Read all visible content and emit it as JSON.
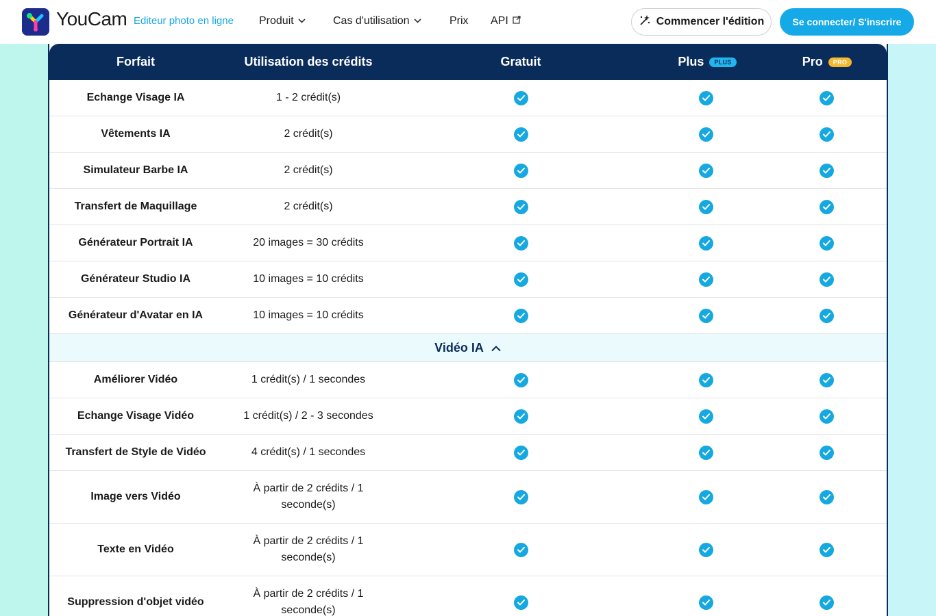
{
  "header": {
    "brand": "YouCam",
    "tagline": "Editeur photo en ligne",
    "nav": [
      {
        "label": "Produit",
        "icon": "chevron-down-icon"
      },
      {
        "label": "Cas d'utilisation",
        "icon": "chevron-down-icon"
      },
      {
        "label": "Prix"
      },
      {
        "label": "API",
        "icon": "external-link-icon"
      }
    ],
    "start_button": "Commencer l'édition",
    "login_button": "Se connecter/ S'inscrire"
  },
  "table": {
    "columns": [
      "Forfait",
      "Utilisation des crédits",
      "Gratuit",
      "Plus",
      "Pro"
    ],
    "plus_badge": "PLUS",
    "pro_badge": "PRO",
    "rows_top": [
      {
        "name": "Echange Visage IA",
        "credits": "1 - 2 crédit(s)"
      },
      {
        "name": "Vêtements IA",
        "credits": "2 crédit(s)"
      },
      {
        "name": "Simulateur Barbe IA",
        "credits": "2 crédit(s)"
      },
      {
        "name": "Transfert de Maquillage",
        "credits": "2 crédit(s)"
      },
      {
        "name": "Générateur Portrait IA",
        "credits": "20 images = 30 crédits"
      },
      {
        "name": "Générateur Studio IA",
        "credits": "10 images = 10 crédits"
      },
      {
        "name": "Générateur d'Avatar en IA",
        "credits": "10 images = 10 crédits"
      }
    ],
    "section_label": "Vidéo IA",
    "rows_video": [
      {
        "name": "Améliorer Vidéo",
        "credits": "1 crédit(s) / 1 secondes"
      },
      {
        "name": "Echange Visage Vidéo",
        "credits": "1 crédit(s) / 2 - 3 secondes"
      },
      {
        "name": "Transfert de Style de Vidéo",
        "credits": "4 crédit(s) / 1 secondes"
      },
      {
        "name": "Image vers Vidéo",
        "credits": "À partir de 2 crédits / 1 seconde(s)"
      },
      {
        "name": "Texte en Vidéo",
        "credits": "À partir de 2 crédits / 1 seconde(s)"
      },
      {
        "name": "Suppression d'objet vidéo",
        "credits": "À partir de 2 crédits / 1 seconde(s)"
      }
    ]
  },
  "colors": {
    "header_navy": "#0a2c5b",
    "accent_blue": "#16a8e0",
    "pro_badge": "#f5b72b"
  }
}
